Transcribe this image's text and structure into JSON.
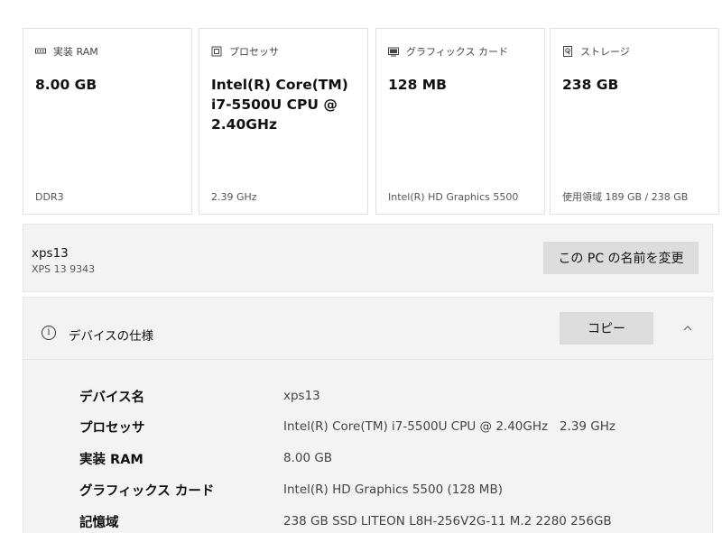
{
  "cards": [
    {
      "label": "実装 RAM",
      "icon": "ram-icon",
      "value": "8.00 GB",
      "sub": "DDR3"
    },
    {
      "label": "プロセッサ",
      "icon": "processor-icon",
      "value": "Intel(R) Core(TM) i7-5500U CPU @ 2.40GHz",
      "sub": "2.39 GHz"
    },
    {
      "label": "グラフィックス カード",
      "icon": "graphics-card-icon",
      "value": "128 MB",
      "sub": "Intel(R) HD Graphics 5500"
    },
    {
      "label": "ストレージ",
      "icon": "storage-icon",
      "value": "238 GB",
      "sub": "使用領域 189 GB / 238 GB"
    }
  ],
  "device": {
    "name": "xps13",
    "model": "XPS 13 9343",
    "rename_label": "この PC の名前を変更"
  },
  "specs": {
    "title": "デバイスの仕様",
    "copy_label": "コピー",
    "rows": [
      {
        "label": "デバイス名",
        "value": "xps13"
      },
      {
        "label": "プロセッサ",
        "value": "Intel(R) Core(TM) i7-5500U CPU @ 2.40GHz   2.39 GHz"
      },
      {
        "label": "実装 RAM",
        "value": "8.00 GB"
      },
      {
        "label": "グラフィックス カード",
        "value": "Intel(R) HD Graphics 5500 (128 MB)"
      },
      {
        "label": "記憶域",
        "value": "238 GB SSD LITEON L8H-256V2G-11 M.2 2280 256GB"
      }
    ]
  }
}
